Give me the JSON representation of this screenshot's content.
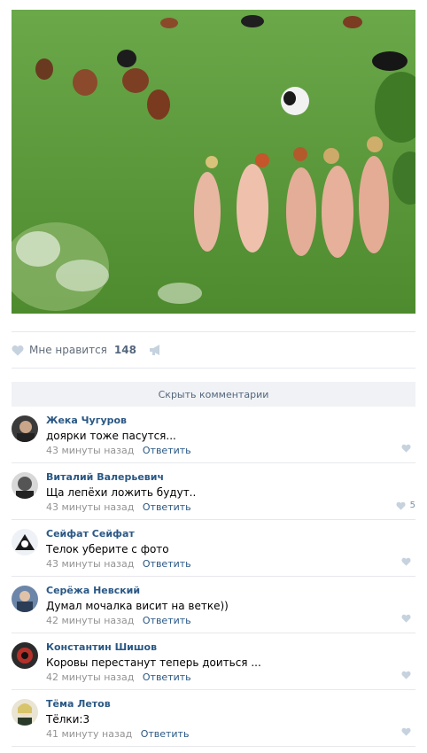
{
  "post": {
    "photo_icon": "photo-pasture",
    "likes": {
      "label": "Мне нравится",
      "count": "148"
    }
  },
  "comments_toggle": "Скрыть комментарии",
  "comments": [
    {
      "author": "Жека Чугуров",
      "text": "доярки тоже пасутся...",
      "time": "43 минуты назад",
      "reply": "Ответить",
      "likes": ""
    },
    {
      "author": "Виталий Валерьевич",
      "text": "Ща лепёхи ложить будут..",
      "time": "43 минуты назад",
      "reply": "Ответить",
      "likes": "5"
    },
    {
      "author": "Сейфат Сейфат",
      "text": "Телок уберите с фото",
      "time": "43 минуты назад",
      "reply": "Ответить",
      "likes": ""
    },
    {
      "author": "Серёжа Невский",
      "text": "Думал мочалка висит на ветке))",
      "time": "42 минуты назад",
      "reply": "Ответить",
      "likes": ""
    },
    {
      "author": "Константин Шишов",
      "text": "Коровы перестанут теперь доиться ...",
      "time": "42 минуты назад",
      "reply": "Ответить",
      "likes": ""
    },
    {
      "author": "Тёма Летов",
      "text": "Тёлки:3",
      "time": "41 минуту назад",
      "reply": "Ответить",
      "likes": ""
    }
  ],
  "colors": {
    "link": "#2a5885",
    "meta": "#939393",
    "bar": "#f0f2f5",
    "grass": "#5f9a3c"
  }
}
